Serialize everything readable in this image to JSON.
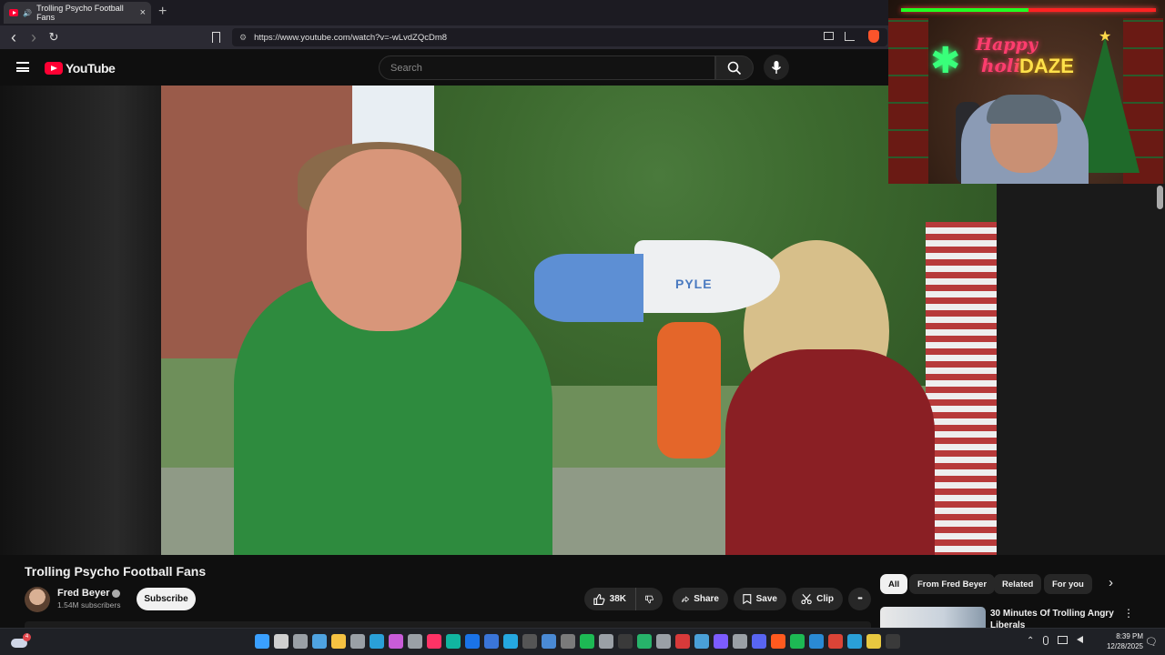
{
  "browser": {
    "tab_title": "Trolling Psycho Football Fans",
    "new_tab": "+",
    "close": "×",
    "url": "https://www.youtube.com/watch?v=-wLvdZQcDm8",
    "nav": {
      "back": "‹",
      "forward": "›",
      "reload": "↻"
    }
  },
  "youtube": {
    "logo_text": "YouTube",
    "search_placeholder": "Search"
  },
  "overlay": {
    "line1": "Happy",
    "line2": "holi",
    "line3": "DAZE"
  },
  "video": {
    "megaphone_brand": "PYLE",
    "title": "Trolling Psycho Football Fans",
    "channel": "Fred Beyer",
    "subscribers": "1.54M subscribers",
    "subscribe_label": "Subscribe",
    "likes": "38K",
    "share_label": "Share",
    "save_label": "Save",
    "clip_label": "Clip",
    "more_label": "•••"
  },
  "sidebar": {
    "chips": [
      "All",
      "From Fred Beyer",
      "Related",
      "For you"
    ],
    "next": "›",
    "rec_title": "30 Minutes Of Trolling Angry Liberals",
    "rec_menu": "⋮"
  },
  "taskbar": {
    "weather_badge": "4",
    "time": "8:39 PM",
    "date": "12/28/2025",
    "tray_up": "⌃",
    "notif": "🗨",
    "icon_colors": [
      "#3aa0ff",
      "#cfcfcf",
      "#9aa0a6",
      "#4fa3e0",
      "#f5c242",
      "#9aa0a6",
      "#2aa0d8",
      "#c95cd8",
      "#9aa0a6",
      "#ff3366",
      "#11b5a0",
      "#1a73e8",
      "#3a75d8",
      "#25a8e0",
      "#555555",
      "#4a8ad4",
      "#7a7a7a",
      "#1db954",
      "#9aa0a6",
      "#3a3a3a",
      "#27b36a",
      "#9aa0a6",
      "#d83a3a",
      "#4aa0d8",
      "#7c5cff",
      "#9aa0a6",
      "#5865f2",
      "#ff5a1f",
      "#1db954",
      "#2a8ad4",
      "#db4437",
      "#2aa0d8",
      "#e8c840",
      "#3a3a3a"
    ]
  }
}
